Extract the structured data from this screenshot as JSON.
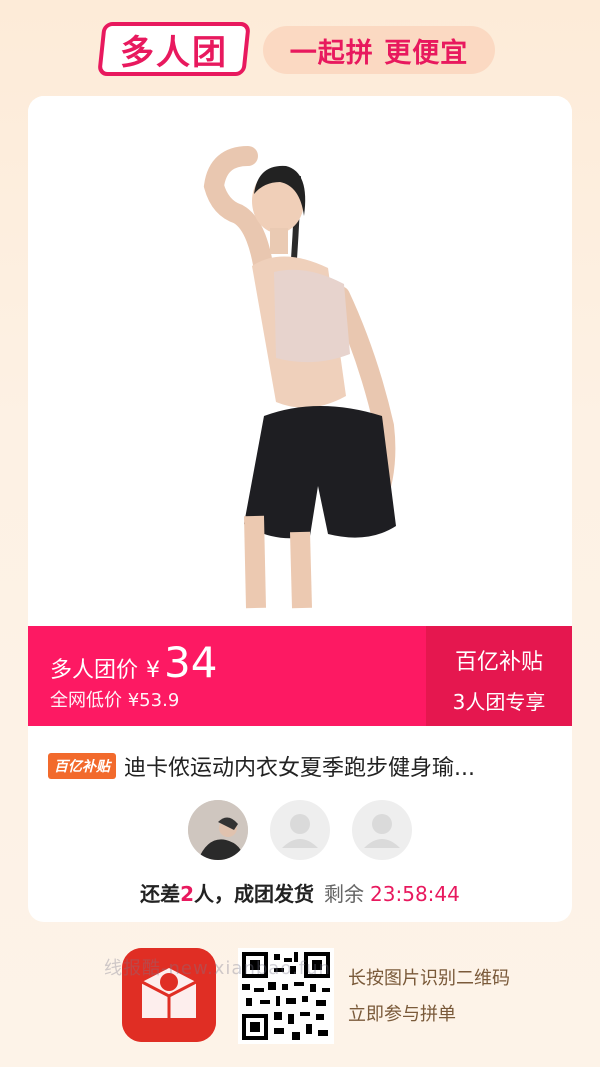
{
  "header": {
    "brand": "多人团",
    "slogan": "一起拼 更便宜"
  },
  "price_bar": {
    "label": "多人团价",
    "currency": "¥",
    "price": "34",
    "sub_label": "全网低价",
    "sub_price": "¥53.9",
    "right_line1": "百亿补贴",
    "right_line2": "3人团专享"
  },
  "product": {
    "badge": "百亿补贴",
    "title": "迪卡侬运动内衣女夏季跑步健身瑜..."
  },
  "group_status": {
    "prefix": "还差",
    "count": "2",
    "suffix": "人，成团发货",
    "remaining_label": "剩余",
    "timer": "23:58:44"
  },
  "footer": {
    "line1": "长按图片识别二维码",
    "line2": "立即参与拼单",
    "watermark": "线报酷-new.xianbao.fun"
  },
  "icons": {
    "app_logo": "pinduoduo-logo-icon",
    "qr": "qr-code-icon",
    "user_placeholder": "user-placeholder-icon"
  },
  "colors": {
    "accent": "#fd1963",
    "accent_dark": "#e5174f",
    "background": "#fdf1e4",
    "slogan_bg": "#fbd9c2"
  }
}
